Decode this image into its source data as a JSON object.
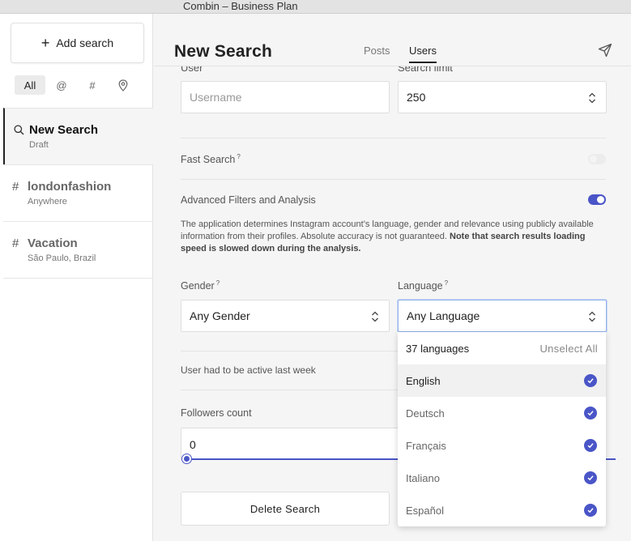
{
  "window": {
    "title": "Combin  – Business Plan"
  },
  "sidebar": {
    "add_search_label": "Add search",
    "filters": [
      {
        "label": "All",
        "icon": "all"
      },
      {
        "label": "@",
        "icon": "at-icon"
      },
      {
        "label": "#",
        "icon": "hashtag-icon"
      },
      {
        "label": "",
        "icon": "location-pin-icon"
      }
    ],
    "searches": [
      {
        "icon": "search-icon",
        "title": "New Search",
        "subtitle": "Draft",
        "active": true
      },
      {
        "icon": "#",
        "title": "londonfashion",
        "subtitle": "Anywhere",
        "active": false
      },
      {
        "icon": "#",
        "title": "Vacation",
        "subtitle": "São Paulo, Brazil",
        "active": false
      }
    ]
  },
  "header": {
    "title": "New Search",
    "tabs": [
      {
        "label": "Posts"
      },
      {
        "label": "Users",
        "selected": true
      }
    ]
  },
  "form": {
    "user_label": "User",
    "user_placeholder": "Username",
    "limit_label": "Search limit",
    "limit_value": "250",
    "fast_search_label": "Fast Search",
    "fast_search_hint": "?",
    "fast_search_on": false,
    "advanced_label": "Advanced Filters and Analysis",
    "advanced_on": true,
    "description_plain": "The application determines Instagram account’s language, gender and relevance using publicly available information from their profiles. Absolute accuracy is not guaranteed.",
    "description_bold": "Note that search results loading speed is slowed down during the analysis.",
    "gender_label": "Gender",
    "gender_hint": "?",
    "gender_value": "Any Gender",
    "language_label": "Language",
    "language_hint": "?",
    "language_value": "Any Language",
    "active_label": "User had to be active last week",
    "followers_label": "Followers count",
    "followers_min": "0",
    "delete_label": "Delete Search"
  },
  "language_dropdown": {
    "count_label": "37 languages",
    "unselect_label": "Unselect All",
    "options": [
      {
        "label": "English",
        "checked": true
      },
      {
        "label": "Deutsch",
        "checked": true
      },
      {
        "label": "Français",
        "checked": true
      },
      {
        "label": "Italiano",
        "checked": true
      },
      {
        "label": "Español",
        "checked": true
      }
    ]
  },
  "colors": {
    "accent": "#4a55c7",
    "focus_border": "#8fb0e8"
  }
}
